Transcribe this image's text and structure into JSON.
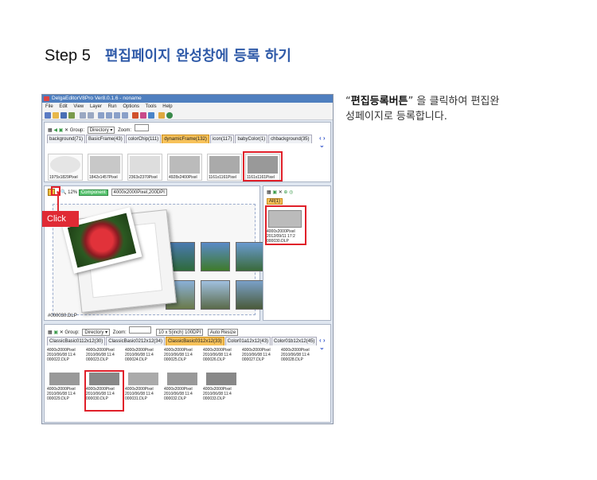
{
  "step": {
    "label": "Step 5",
    "title": "편집페이지 완성창에 등록 하기"
  },
  "description": {
    "quote_open": "“",
    "button_name": "편집등록버튼",
    "quote_close": "”",
    "text_line1": " 을 클릭하여 편집완",
    "text_line2": "성페이지로 등록합니다."
  },
  "app": {
    "title": "DelgaEditorV8Pro Ver8.0.1.6 - noname",
    "menu": [
      "File",
      "Edit",
      "View",
      "Layer",
      "Run",
      "Options",
      "Tools",
      "Help"
    ]
  },
  "top_panel": {
    "group_label": "Group:",
    "group_value": "Directory",
    "zoom_label": "Zoom:",
    "tabs": [
      "background(71)",
      "BasicFrame(43)",
      "colorChip(111)",
      "dynamicFrame(132)",
      "icon(117)",
      "babyColor(1)",
      "chbackground(35)"
    ],
    "active_tab": "dynamicFrame(132)",
    "thumbs": [
      "1975x1829Pixel",
      "1842x1457Pixel",
      "2363x2370Pixel",
      "4928x2400Pixel",
      "1161x1161Pixel",
      "1161x1161Pixel"
    ]
  },
  "editor": {
    "zoom_value": "12%",
    "mode_badge": "Component",
    "size_info": "4000x2000Pixel,200DPI",
    "filename": "#000030.DLP",
    "click_label": "Click"
  },
  "right_panel": {
    "tab": "All(1)",
    "item_lines": [
      "4000x2000Pixel",
      "2012/09/11 17:2",
      "000030.DLP"
    ]
  },
  "bottom_panel": {
    "group_label": "Group:",
    "group_value": "Directory",
    "zoom_label": "Zoom:",
    "size_text": "10 x 5(inch)",
    "dpi_text": "100DPI",
    "auto_resize": "Auto Resize",
    "tabs": [
      "ClassicBasic0112x12(30)",
      "ClassicBasic0212x12(34)",
      "ClassicBasic0312x12(33)",
      "Color01a12x12(43)",
      "Color01b12x12(45)"
    ],
    "active_tab": "ClassicBasic0312x12(33)",
    "row1": [
      {
        "size": "4000x2000Pixel",
        "date": "2010/06/08 11:4",
        "file": "000022.DLP"
      },
      {
        "size": "4000x2000Pixel",
        "date": "2010/06/08 11:4",
        "file": "000023.DLP"
      },
      {
        "size": "4000x2000Pixel",
        "date": "2010/06/08 11:4",
        "file": "000024.DLP"
      },
      {
        "size": "4000x2000Pixel",
        "date": "2010/06/08 11:4",
        "file": "000025.DLP"
      },
      {
        "size": "4000x2000Pixel",
        "date": "2010/06/08 11:4",
        "file": "000026.DLP"
      },
      {
        "size": "4000x2000Pixel",
        "date": "2010/06/08 11:4",
        "file": "000027.DLP"
      },
      {
        "size": "4000x2000Pixel",
        "date": "2010/06/08 11:4",
        "file": "000028.DLP"
      }
    ],
    "row2": [
      {
        "size": "4000x2000Pixel",
        "date": "2010/06/08 11:4",
        "file": "000029.DLP"
      },
      {
        "size": "4000x2000Pixel",
        "date": "2010/06/08 11:4",
        "file": "000030.DLP"
      },
      {
        "size": "4000x2000Pixel",
        "date": "2010/06/08 11:4",
        "file": "000031.DLP"
      },
      {
        "size": "4000x2000Pixel",
        "date": "2010/06/08 11:4",
        "file": "000032.DLP"
      },
      {
        "size": "4000x2000Pixel",
        "date": "2010/06/08 11:4",
        "file": "000033.DLP"
      }
    ]
  },
  "colors": {
    "accent": "#2f5aa8",
    "highlight": "#e0202a",
    "active_tab": "#f7c25a"
  }
}
